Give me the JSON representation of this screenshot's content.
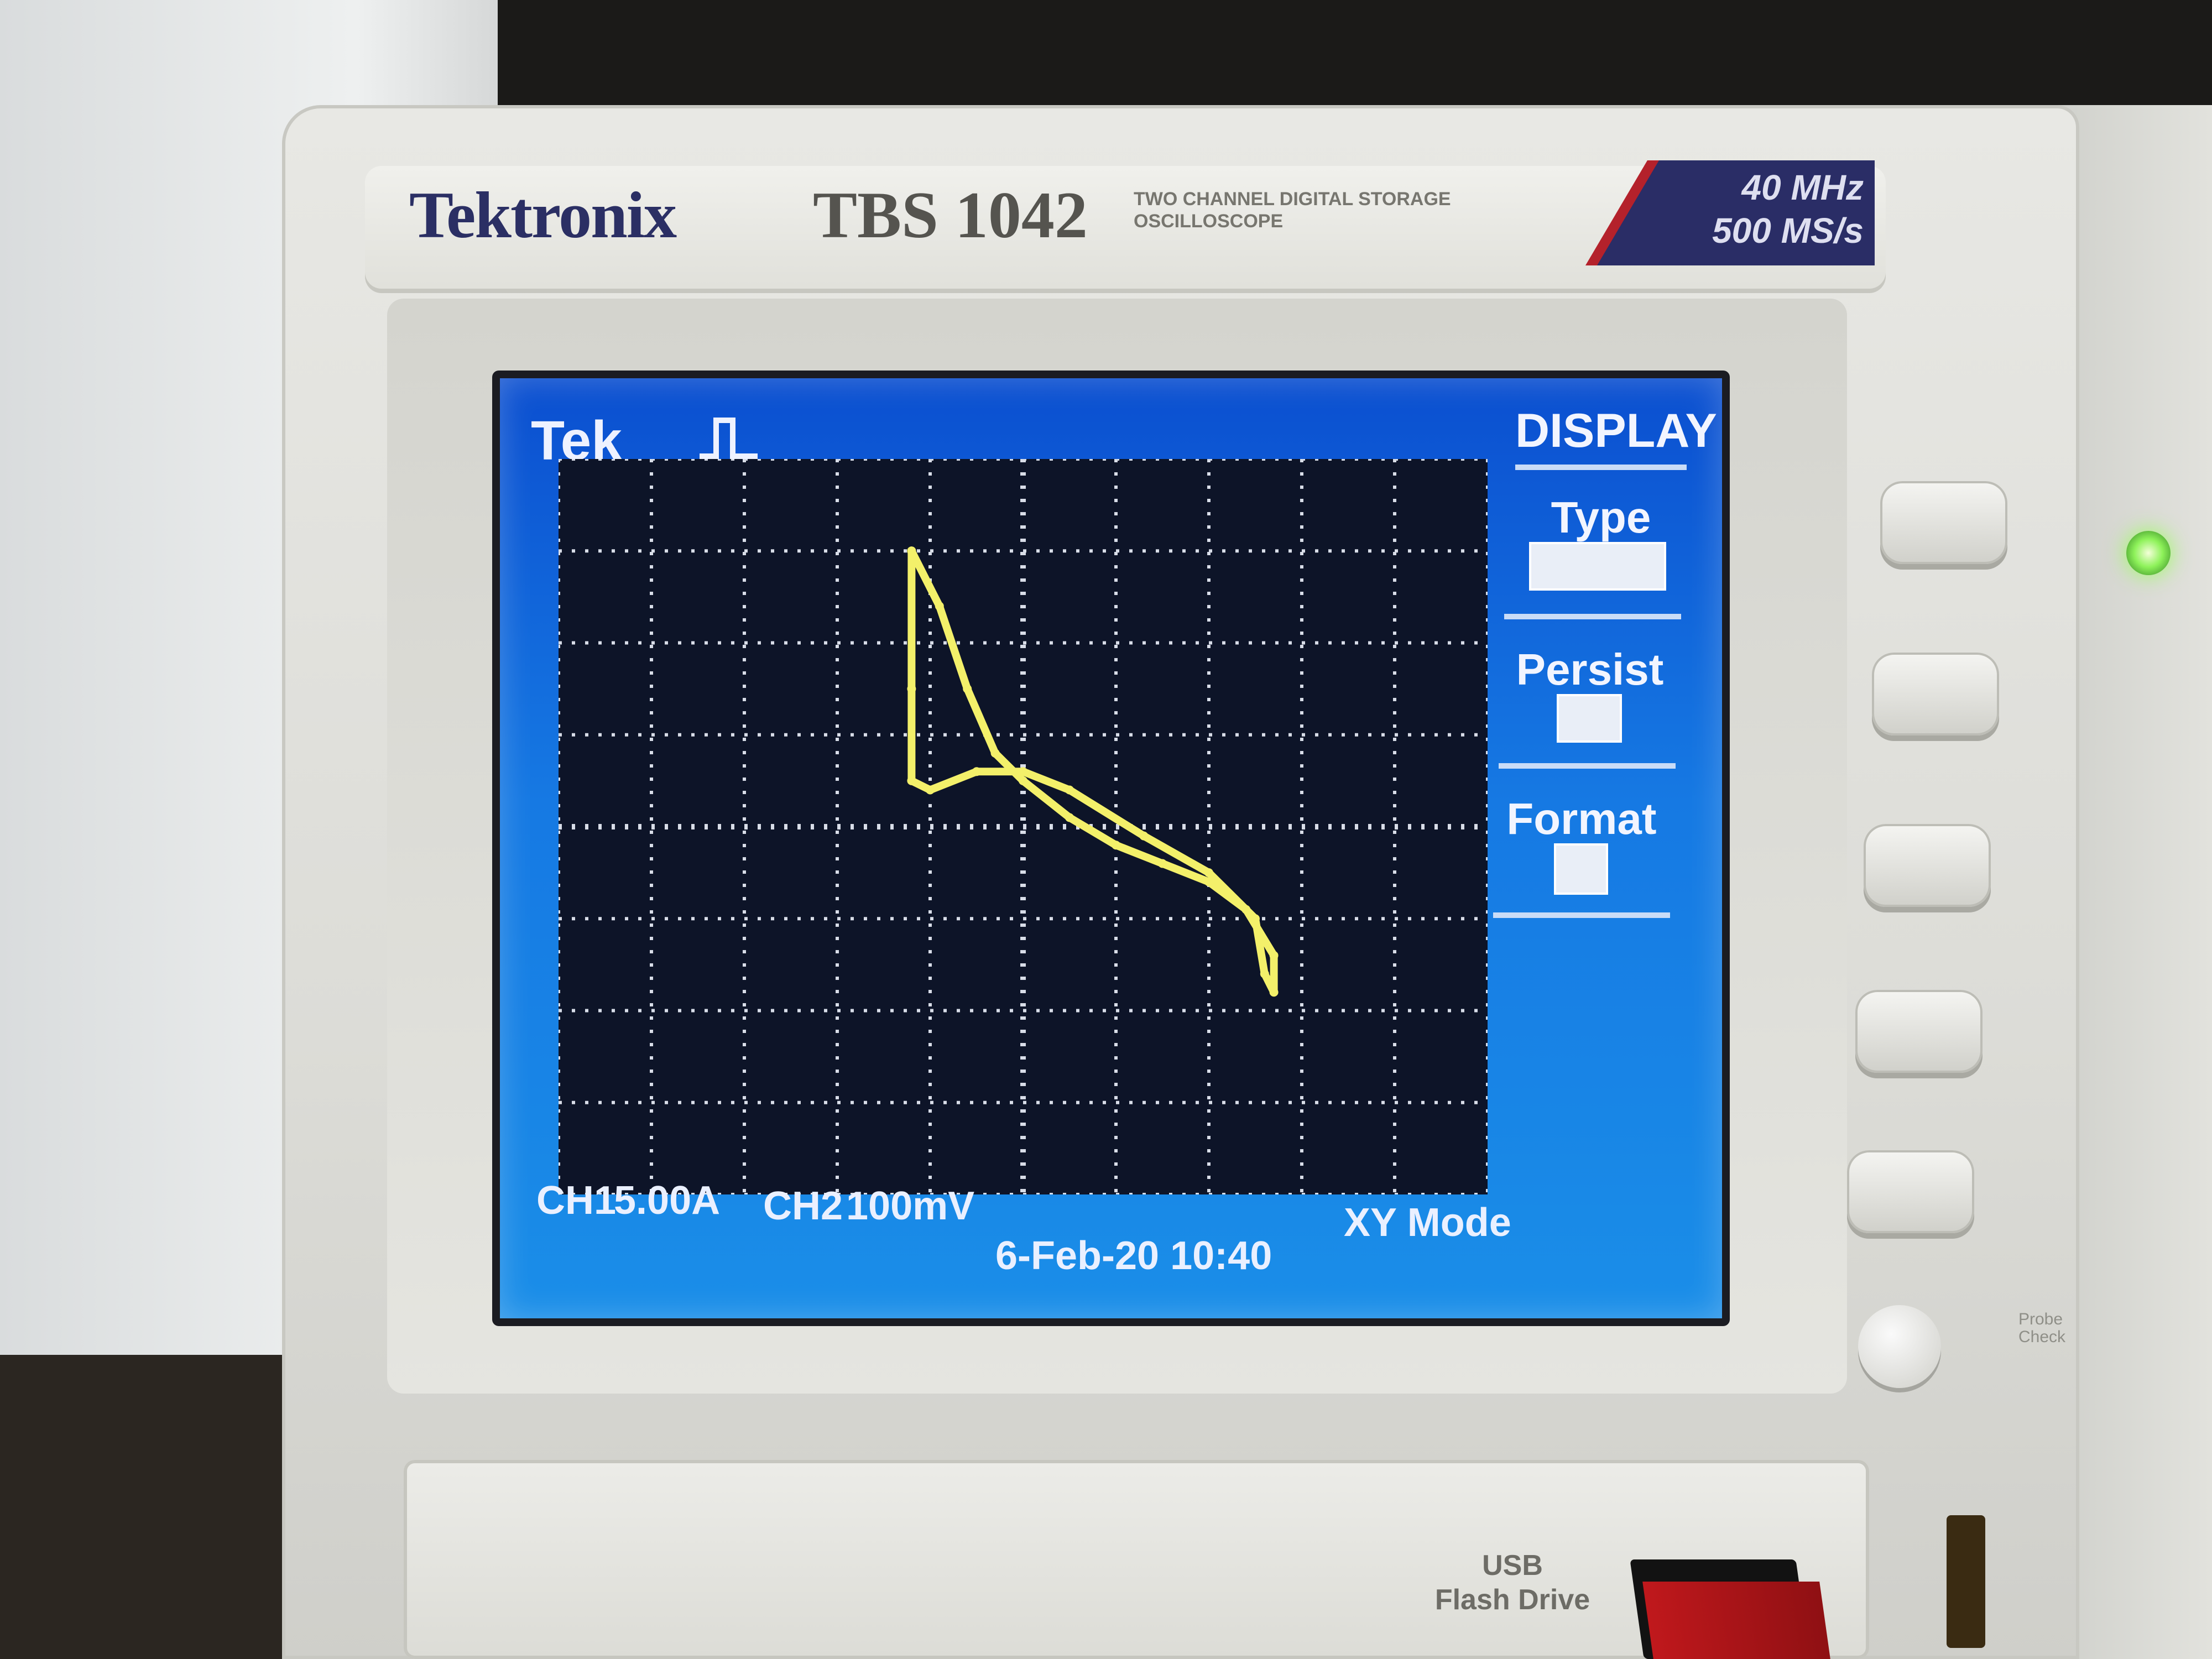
{
  "device": {
    "brand": "Tektronix",
    "model": "TBS 1042",
    "description": "TWO CHANNEL DIGITAL STORAGE OSCILLOSCOPE",
    "spec_line1": "40 MHz",
    "spec_line2": "500 MS/s",
    "probe_check_label": "Probe Check",
    "usb_label_line1": "USB",
    "usb_label_line2": "Flash Drive",
    "led_color": "#8ef25a"
  },
  "screen": {
    "header": "Tek",
    "trigger_icon": "trigger-state-icon",
    "menu": {
      "title": "DISPLAY",
      "items": [
        {
          "label": "Type",
          "value": ""
        },
        {
          "label": "Persist",
          "value": ""
        },
        {
          "label": "Format",
          "value": ""
        }
      ]
    },
    "readouts": {
      "ch1_label": "CH1",
      "ch1_scale": "5.00A",
      "ch2_label": "CH2",
      "ch2_scale": "100mV",
      "mode": "XY Mode",
      "datetime": "6-Feb-20 10:40"
    },
    "trace_color": "#f3f06a",
    "background_color": "#1a7ee5",
    "graticule_color": "#d8dde8"
  },
  "chart_data": {
    "type": "scatter",
    "title": "",
    "xlabel": "",
    "ylabel": "",
    "grid": true,
    "xlim": [
      -5,
      5
    ],
    "ylim": [
      -4,
      4
    ],
    "x_divisions": 10,
    "y_divisions": 8,
    "series": [
      {
        "values_xy": [
          [
            -1.2,
            3.0
          ],
          [
            -0.9,
            2.4
          ],
          [
            -0.6,
            1.5
          ],
          [
            -0.3,
            0.8
          ],
          [
            0.0,
            0.5
          ],
          [
            0.5,
            0.1
          ],
          [
            1.0,
            -0.2
          ],
          [
            1.5,
            -0.4
          ],
          [
            2.0,
            -0.6
          ],
          [
            2.4,
            -0.9
          ],
          [
            2.7,
            -1.4
          ],
          [
            2.7,
            -1.8
          ],
          [
            2.6,
            -1.6
          ],
          [
            2.5,
            -1.0
          ],
          [
            2.0,
            -0.5
          ],
          [
            1.3,
            -0.1
          ],
          [
            0.5,
            0.4
          ],
          [
            0.0,
            0.6
          ],
          [
            -0.5,
            0.6
          ],
          [
            -1.0,
            0.4
          ],
          [
            -1.2,
            0.5
          ],
          [
            -1.2,
            1.5
          ],
          [
            -1.2,
            3.0
          ]
        ]
      }
    ]
  }
}
